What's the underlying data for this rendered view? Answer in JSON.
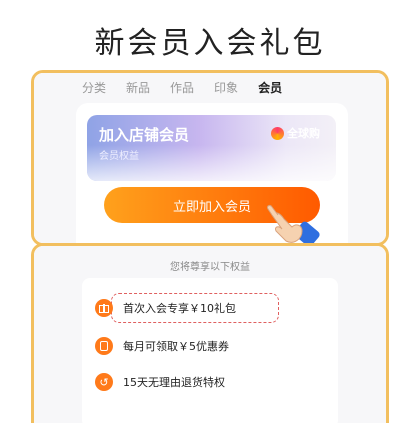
{
  "title": "新会员入会礼包",
  "tabs": [
    {
      "label": "分类",
      "active": false
    },
    {
      "label": "新品",
      "active": false
    },
    {
      "label": "作品",
      "active": false
    },
    {
      "label": "印象",
      "active": false
    },
    {
      "label": "会员",
      "active": true
    }
  ],
  "member_card": {
    "title": "加入店铺会员",
    "subtitle": "会员权益",
    "brand": "全球购"
  },
  "join_button": "立即加入会员",
  "benefits_heading": "您将尊享以下权益",
  "benefits": [
    {
      "icon": "gift-icon",
      "text": "首次入会专享￥10礼包"
    },
    {
      "icon": "coupon-icon",
      "text": "每月可领取￥5优惠券"
    },
    {
      "icon": "return-icon",
      "text": "15天无理由退货特权"
    }
  ],
  "colors": {
    "accent": "#ff6a00",
    "frame": "#f2bf5f"
  }
}
